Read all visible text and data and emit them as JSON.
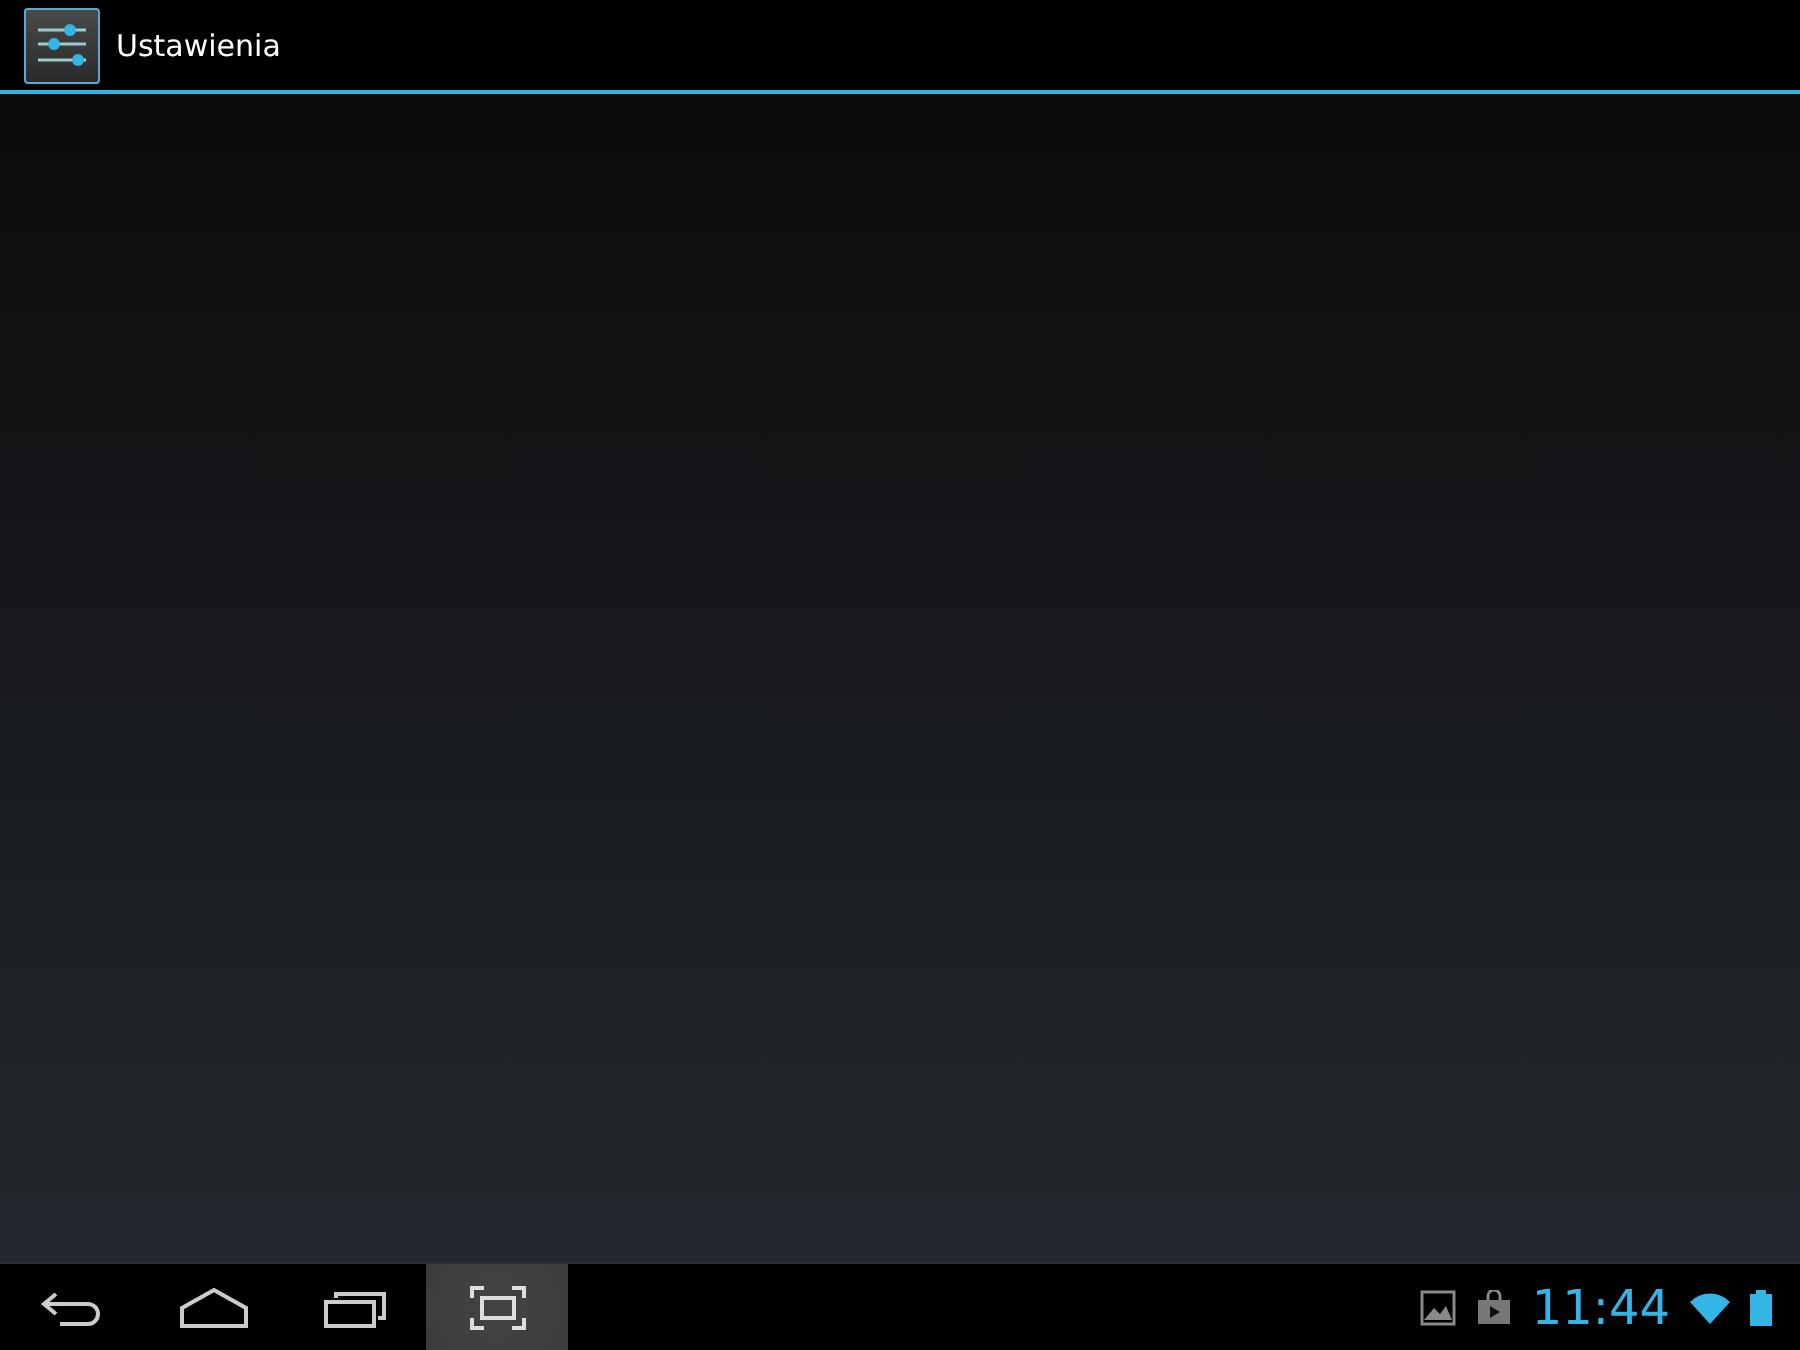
{
  "action_bar": {
    "title": "Ustawienia"
  },
  "nav_bar": {
    "buttons": [
      {
        "kind": "back",
        "pressed": false
      },
      {
        "kind": "home",
        "pressed": false
      },
      {
        "kind": "recents",
        "pressed": false
      },
      {
        "kind": "screenshot",
        "pressed": true
      }
    ]
  },
  "status_area": {
    "notifications": [
      {
        "kind": "gallery"
      },
      {
        "kind": "store"
      }
    ],
    "time": "11:44"
  }
}
